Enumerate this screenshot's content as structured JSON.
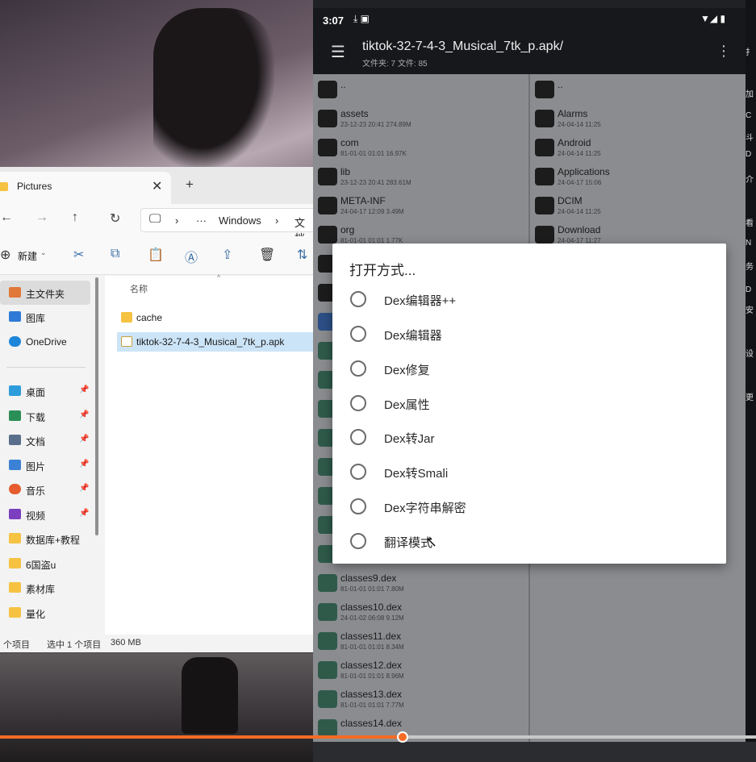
{
  "explorer": {
    "tab_title": "Pictures",
    "path": {
      "root": "Windows",
      "next": "文档",
      "ellipsis": "···"
    },
    "toolbar": {
      "new_label": "新建"
    },
    "sidebar": [
      {
        "label": "主文件夹",
        "icon": "home-icon",
        "color": "#e0783a"
      },
      {
        "label": "图库",
        "icon": "gallery-icon",
        "color": "#2f7ad6"
      },
      {
        "label": "OneDrive",
        "icon": "cloud-icon",
        "color": "#1d86d9"
      },
      {
        "label": "桌面",
        "icon": "desktop-icon",
        "color": "#2d9cdb"
      },
      {
        "label": "下载",
        "icon": "download-icon",
        "color": "#2a8f57"
      },
      {
        "label": "文档",
        "icon": "document-icon",
        "color": "#5a6f8c"
      },
      {
        "label": "图片",
        "icon": "picture-icon",
        "color": "#3b82d6"
      },
      {
        "label": "音乐",
        "icon": "music-icon",
        "color": "#e65c2f"
      },
      {
        "label": "视频",
        "icon": "video-icon",
        "color": "#7b3fbf"
      },
      {
        "label": "数据库+教程",
        "icon": "folder-icon",
        "color": "#f5c242"
      },
      {
        "label": "6国盗u",
        "icon": "folder-icon",
        "color": "#f5c242"
      },
      {
        "label": "素材库",
        "icon": "folder-icon",
        "color": "#f5c242"
      },
      {
        "label": "量化",
        "icon": "folder-icon",
        "color": "#f5c242"
      }
    ],
    "column_name": "名称",
    "files": [
      {
        "name": "cache",
        "icon": "folder-icon",
        "color": "#f5c242"
      },
      {
        "name": "tiktok-32-7-4-3_Musical_7tk_p.apk",
        "icon": "apk-file-icon",
        "color": "#c8a23a"
      }
    ],
    "status": {
      "count": "个项目",
      "selected": "选中 1 个项目",
      "size": "360 MB"
    }
  },
  "phone": {
    "status_bar": {
      "time": "3:07"
    },
    "app_bar": {
      "title": "tiktok-32-7-4-3_Musical_7tk_p.apk/",
      "subtitle": "文件夹: 7  文件: 85"
    },
    "left_pane": [
      {
        "name": "..",
        "meta": ""
      },
      {
        "name": "assets",
        "meta": "23-12-23 20:41  274.89M"
      },
      {
        "name": "com",
        "meta": "81-01-01 01:01  16.97K"
      },
      {
        "name": "lib",
        "meta": "23-12-23 20:41  283.61M"
      },
      {
        "name": "META-INF",
        "meta": "24-04-17 12:09  3.49M"
      },
      {
        "name": "org",
        "meta": "81-01-01 01:01  1.77K"
      }
    ],
    "left_pane_bottom": [
      {
        "name": "classes9.dex",
        "meta": "81-01-01 01:01  7.80M"
      },
      {
        "name": "classes10.dex",
        "meta": "24-01-02 06:08  9.12M"
      },
      {
        "name": "classes11.dex",
        "meta": "81-01-01 01:01  8.34M"
      },
      {
        "name": "classes12.dex",
        "meta": "81-01-01 01:01  8.96M"
      },
      {
        "name": "classes13.dex",
        "meta": "81-01-01 01:01  7.77M"
      },
      {
        "name": "classes14.dex",
        "meta": ""
      }
    ],
    "right_pane": [
      {
        "name": "..",
        "meta": ""
      },
      {
        "name": "Alarms",
        "meta": "24-04-14 11:25"
      },
      {
        "name": "Android",
        "meta": "24-04-14 11:25"
      },
      {
        "name": "Applications",
        "meta": "24-04-17 15:06"
      },
      {
        "name": "DCIM",
        "meta": "24-04-14 11:25"
      },
      {
        "name": "Download",
        "meta": "24-04-17 11:27"
      }
    ]
  },
  "dialog": {
    "title": "打开方式...",
    "options": [
      "Dex编辑器++",
      "Dex编辑器",
      "Dex修复",
      "Dex属性",
      "Dex转Jar",
      "Dex转Smali",
      "Dex字符串解密",
      "翻译模式"
    ]
  },
  "side_strip": [
    "扌",
    "加",
    "C",
    "斗",
    "D",
    "介",
    "看",
    "N",
    "务",
    "D",
    "安",
    "设",
    "更"
  ],
  "progress": {
    "value_fraction": 0.533,
    "color": "#f46c25"
  }
}
